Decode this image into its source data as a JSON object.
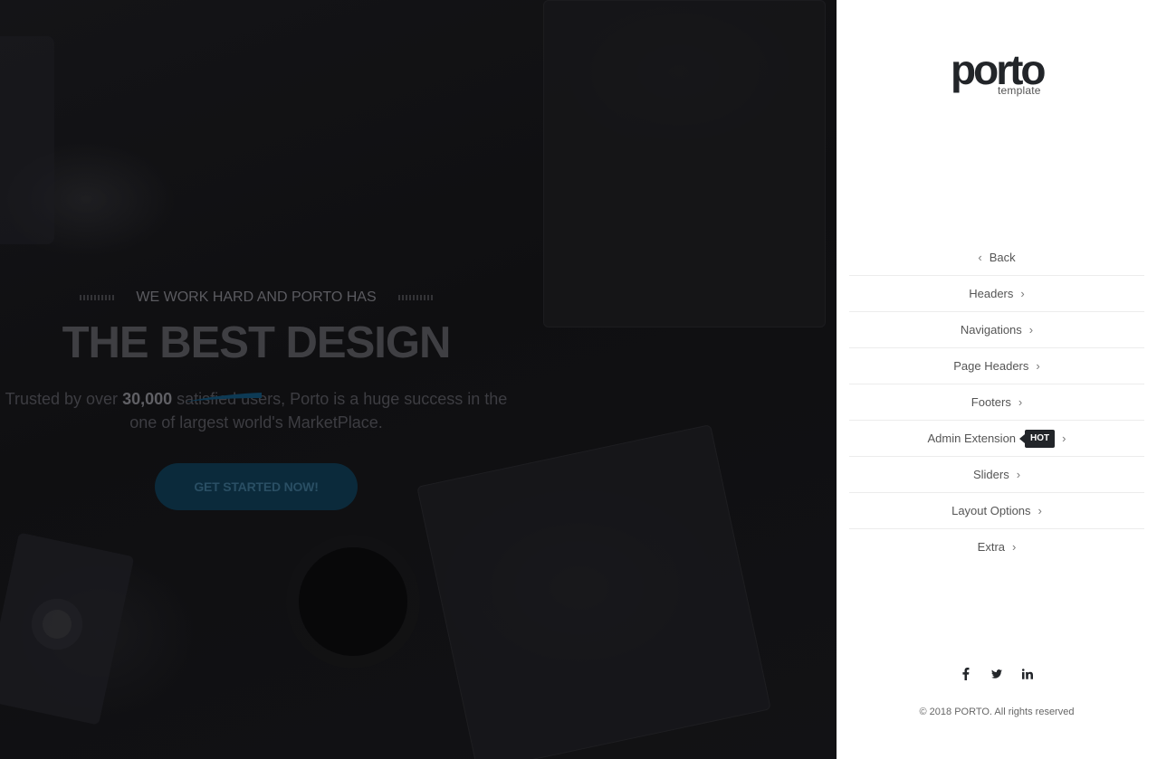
{
  "hero": {
    "kicker": "WE WORK HARD AND PORTO HAS",
    "headline": "THE BEST DESIGN",
    "subtext_pre": "Trusted by over ",
    "subtext_bold": "30,000",
    "subtext_post": " satisfied users, Porto is a huge success in the one of largest world's MarketPlace.",
    "cta_label": "GET STARTED NOW!"
  },
  "sidebar": {
    "logo_word": "porto",
    "logo_sub": "template",
    "back_label": "Back",
    "menu": [
      {
        "label": "Headers"
      },
      {
        "label": "Navigations"
      },
      {
        "label": "Page Headers"
      },
      {
        "label": "Footers"
      },
      {
        "label": "Admin Extension",
        "badge": "HOT"
      },
      {
        "label": "Sliders"
      },
      {
        "label": "Layout Options"
      },
      {
        "label": "Extra"
      }
    ],
    "social": [
      "facebook-icon",
      "twitter-icon",
      "linkedin-icon"
    ],
    "copyright": "© 2018 PORTO. All rights reserved"
  },
  "colors": {
    "sidebar_bg": "#ffffff",
    "overlay": "#0d0d0f",
    "cta_bg": "#0b2a3b",
    "hot_badge": "#222529"
  }
}
